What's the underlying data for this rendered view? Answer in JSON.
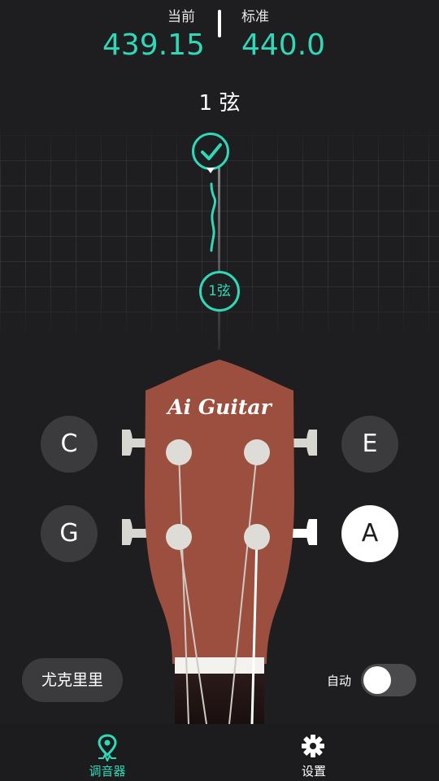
{
  "header": {
    "current_label": "当前",
    "current_value": "439.15",
    "standard_label": "标准",
    "standard_value": "440.0"
  },
  "string_title": "1 弦",
  "meter": {
    "status_icon": "check-icon",
    "string_marker": "1弦"
  },
  "headstock": {
    "brand": "Ai Guitar"
  },
  "notes": {
    "c": "C",
    "e": "E",
    "g": "G",
    "a": "A",
    "active": "A"
  },
  "controls": {
    "instrument_button": "尤克里里",
    "auto_label": "自动",
    "auto_enabled": false
  },
  "nav": {
    "tuner_label": "调音器",
    "tuner_icon": "location-pin-pulse-icon",
    "settings_label": "设置",
    "settings_icon": "gear-icon"
  },
  "colors": {
    "accent": "#2fd9b8",
    "background": "#1e1e20",
    "headstock_wood": "#9c4f3e"
  }
}
